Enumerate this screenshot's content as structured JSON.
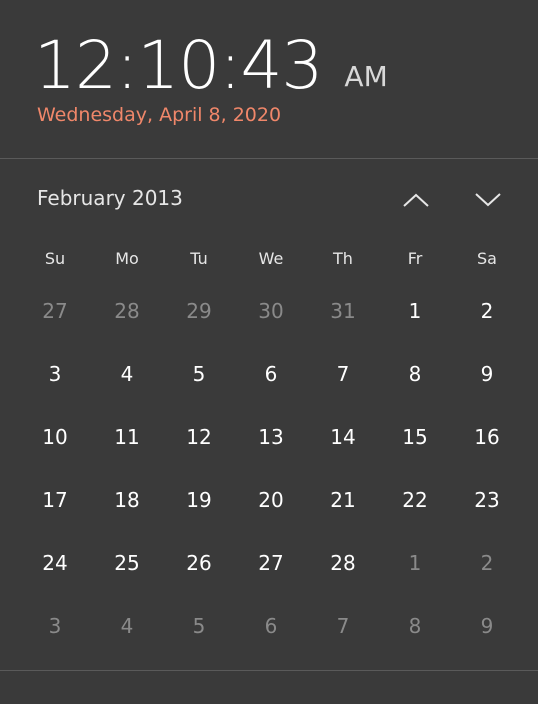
{
  "clock": {
    "time": "12:10:43",
    "ampm": "AM",
    "date": "Wednesday, April 8, 2020"
  },
  "calendar": {
    "month_label": "February 2013",
    "prev_icon": "chevron-up-icon",
    "next_icon": "chevron-down-icon",
    "weekdays": [
      "Su",
      "Mo",
      "Tu",
      "We",
      "Th",
      "Fr",
      "Sa"
    ],
    "weeks": [
      [
        {
          "d": "27",
          "other": true
        },
        {
          "d": "28",
          "other": true
        },
        {
          "d": "29",
          "other": true
        },
        {
          "d": "30",
          "other": true
        },
        {
          "d": "31",
          "other": true
        },
        {
          "d": "1",
          "other": false
        },
        {
          "d": "2",
          "other": false
        }
      ],
      [
        {
          "d": "3",
          "other": false
        },
        {
          "d": "4",
          "other": false
        },
        {
          "d": "5",
          "other": false
        },
        {
          "d": "6",
          "other": false
        },
        {
          "d": "7",
          "other": false
        },
        {
          "d": "8",
          "other": false
        },
        {
          "d": "9",
          "other": false
        }
      ],
      [
        {
          "d": "10",
          "other": false
        },
        {
          "d": "11",
          "other": false
        },
        {
          "d": "12",
          "other": false
        },
        {
          "d": "13",
          "other": false
        },
        {
          "d": "14",
          "other": false
        },
        {
          "d": "15",
          "other": false
        },
        {
          "d": "16",
          "other": false
        }
      ],
      [
        {
          "d": "17",
          "other": false
        },
        {
          "d": "18",
          "other": false
        },
        {
          "d": "19",
          "other": false
        },
        {
          "d": "20",
          "other": false
        },
        {
          "d": "21",
          "other": false
        },
        {
          "d": "22",
          "other": false
        },
        {
          "d": "23",
          "other": false
        }
      ],
      [
        {
          "d": "24",
          "other": false
        },
        {
          "d": "25",
          "other": false
        },
        {
          "d": "26",
          "other": false
        },
        {
          "d": "27",
          "other": false
        },
        {
          "d": "28",
          "other": false
        },
        {
          "d": "1",
          "other": true
        },
        {
          "d": "2",
          "other": true
        }
      ],
      [
        {
          "d": "3",
          "other": true
        },
        {
          "d": "4",
          "other": true
        },
        {
          "d": "5",
          "other": true
        },
        {
          "d": "6",
          "other": true
        },
        {
          "d": "7",
          "other": true
        },
        {
          "d": "8",
          "other": true
        },
        {
          "d": "9",
          "other": true
        }
      ]
    ]
  },
  "colors": {
    "background": "#3a3a3a",
    "accent_date": "#f0876a",
    "text": "#ffffff",
    "muted_day": "#8a8a8a",
    "divider": "#5a5a5a"
  }
}
